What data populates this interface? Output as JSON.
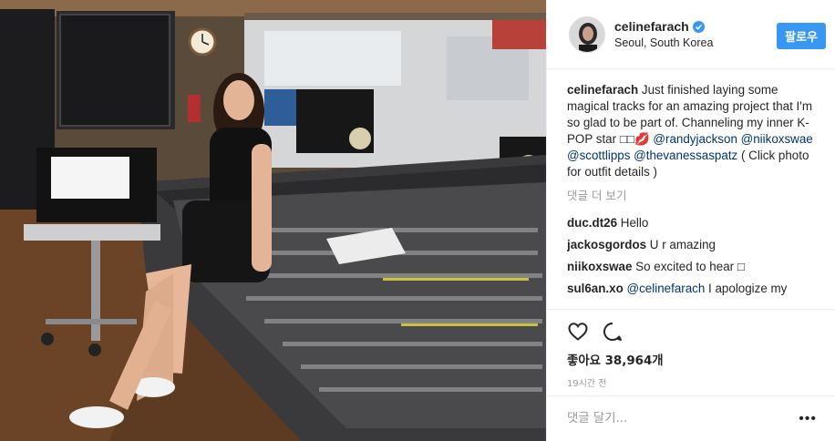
{
  "post": {
    "username": "celinefarach",
    "location": "Seoul, South Korea",
    "follow_label": "팔로우",
    "caption": {
      "user": "celinefarach",
      "text_before": " Just finished laying some magical tracks for an amazing project that I'm so glad to be part of. Channeling my inner K-POP star ",
      "emoji": "□□💋",
      "mentions": [
        "@randyjackson",
        "@niikoxswae",
        "@scottlipps",
        "@thevanessaspatz"
      ],
      "text_after": " ( Click photo for outfit details )"
    },
    "load_more_label": "댓글 더 보기",
    "comments": [
      {
        "user": "duc.dt26",
        "text": " Hello",
        "mention": ""
      },
      {
        "user": "jackosgordos",
        "text": " U r amazing",
        "mention": ""
      },
      {
        "user": "niikoxswae",
        "text": " So excited to hear □",
        "mention": ""
      },
      {
        "user": "sul6an.xo",
        "text": " I apologize my",
        "mention": "@celinefarach"
      }
    ],
    "likes_label": "좋아요 38,964개",
    "timestamp": "19시간 전",
    "comment_placeholder": "댓글 달기...",
    "more_label": "•••",
    "icons": {
      "verified": "verified-badge-icon",
      "like": "heart-icon",
      "comment": "comment-bubble-icon",
      "more": "more-options-icon"
    },
    "colors": {
      "follow_button": "#3897f0",
      "mention": "#003569",
      "muted": "#999999",
      "verified": "#3897f0"
    }
  }
}
